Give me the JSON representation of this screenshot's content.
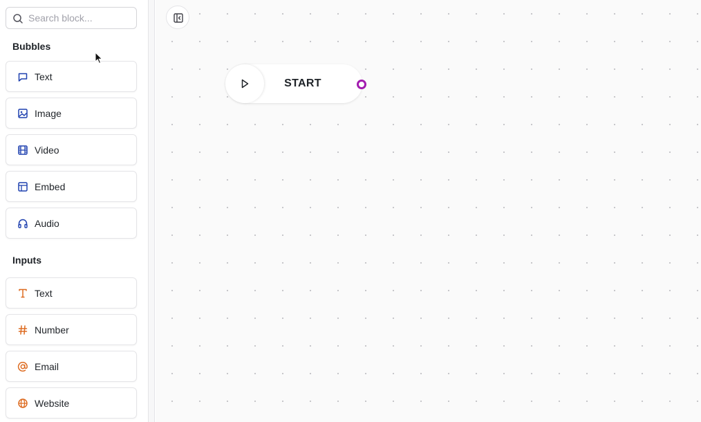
{
  "search": {
    "placeholder": "Search block..."
  },
  "bubbles": {
    "title": "Bubbles",
    "items": [
      {
        "label": "Text",
        "icon": "chat-bubble-icon"
      },
      {
        "label": "Image",
        "icon": "image-icon"
      },
      {
        "label": "Video",
        "icon": "film-icon"
      },
      {
        "label": "Embed",
        "icon": "layout-icon"
      },
      {
        "label": "Audio",
        "icon": "headphones-icon"
      }
    ]
  },
  "inputs": {
    "title": "Inputs",
    "items": [
      {
        "label": "Text",
        "icon": "text-type-icon"
      },
      {
        "label": "Number",
        "icon": "hash-icon"
      },
      {
        "label": "Email",
        "icon": "at-sign-icon"
      },
      {
        "label": "Website",
        "icon": "globe-icon"
      }
    ]
  },
  "canvas": {
    "start_node": {
      "label": "START"
    }
  },
  "colors": {
    "bubble_icon": "#1e40af",
    "input_icon": "#dd6b20",
    "endpoint": "#a21caf"
  }
}
